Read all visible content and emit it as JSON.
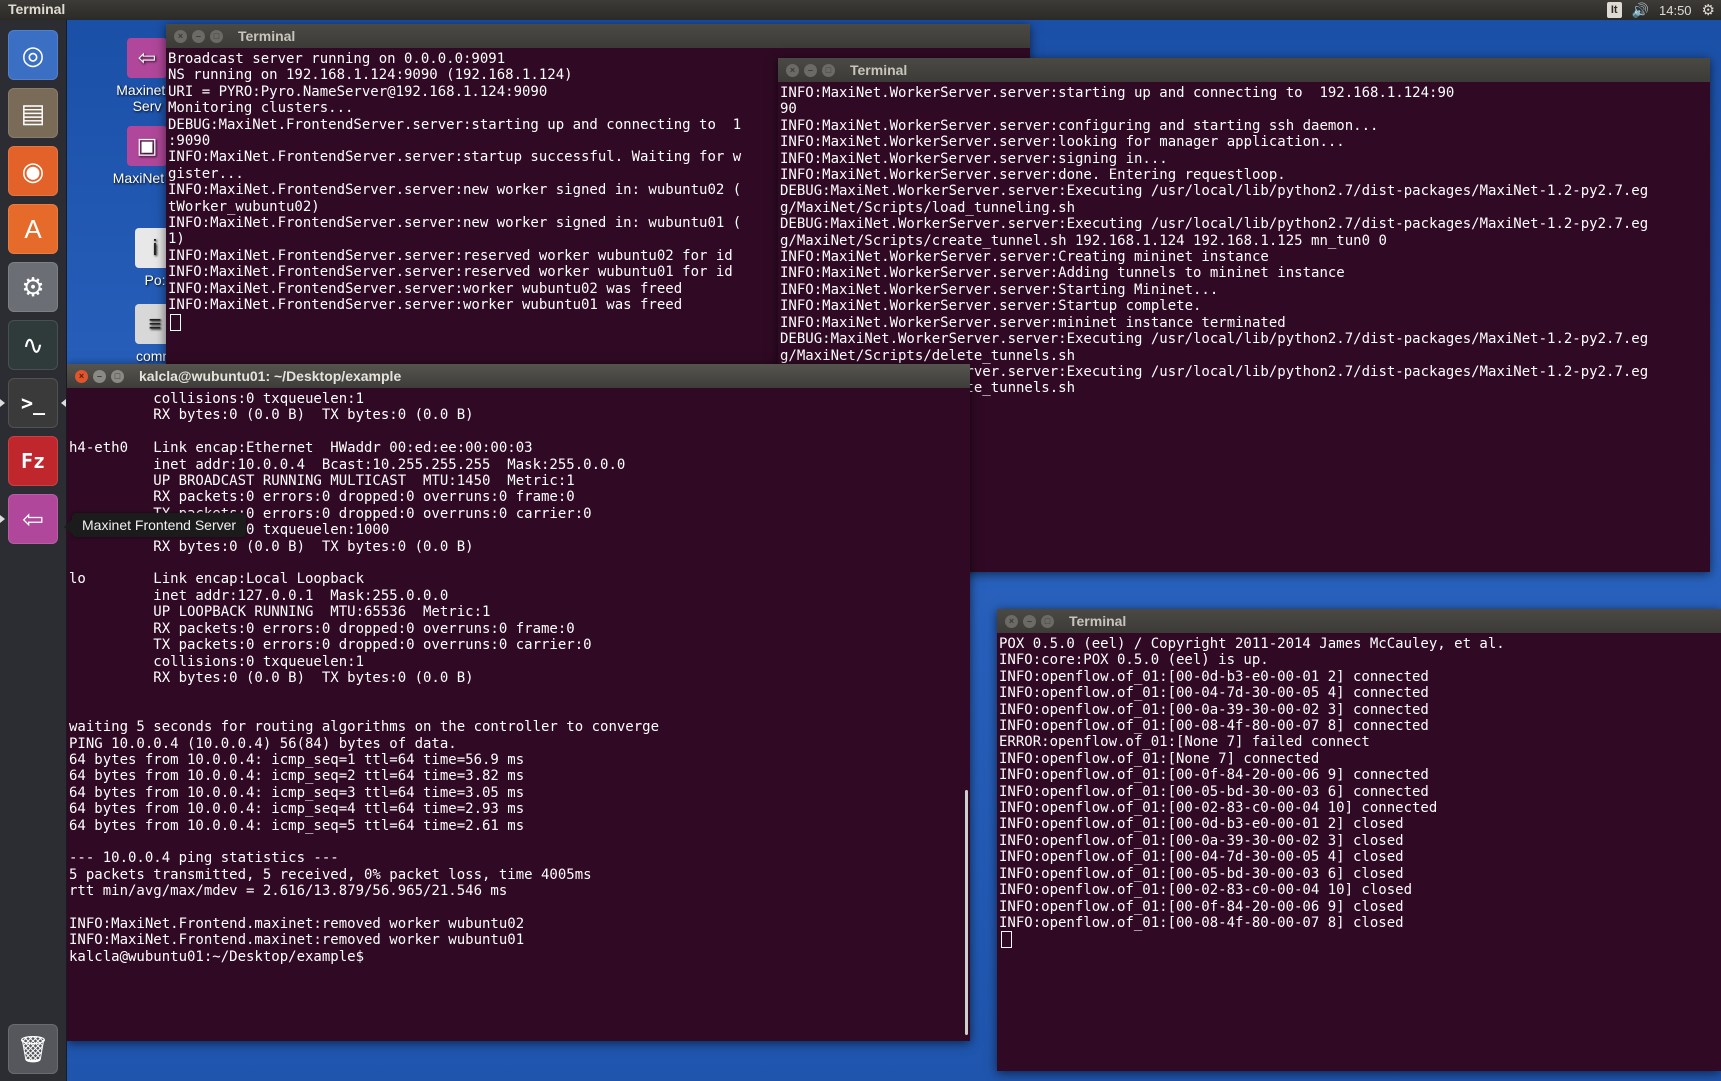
{
  "top_panel": {
    "app_title": "Terminal",
    "keyboard": "It",
    "volume_icon": "volume-icon",
    "clock": "14:50",
    "settings_icon": "gear-icon"
  },
  "launcher": {
    "items": [
      {
        "name": "dash-icon",
        "glyph": "◎",
        "bg": "#3b6fc4"
      },
      {
        "name": "files-icon",
        "glyph": "▤",
        "bg": "#7a6a58"
      },
      {
        "name": "firefox-icon",
        "glyph": "◉",
        "bg": "#e2622a"
      },
      {
        "name": "software-center-icon",
        "glyph": "A",
        "bg": "#e66a2a"
      },
      {
        "name": "system-settings-icon",
        "glyph": "⚙",
        "bg": "#6b6f75"
      },
      {
        "name": "system-monitor-icon",
        "glyph": "∿",
        "bg": "#2f3a3a"
      },
      {
        "name": "terminal-icon",
        "glyph": ">_",
        "bg": "#3a3a3a"
      },
      {
        "name": "filezilla-icon",
        "glyph": "Fz",
        "bg": "#c0272d"
      },
      {
        "name": "maxinet-frontend-icon",
        "glyph": "⇦",
        "bg": "#b0479a"
      }
    ],
    "trash_glyph": "🗑",
    "tooltip": "Maxinet Frontend Server"
  },
  "desktop_icons": [
    {
      "label": "Maxinet F\nServ",
      "glyph": "⇦",
      "bg": "#b0479a"
    },
    {
      "label": "MaxiNet W",
      "glyph": "▣",
      "bg": "#b0479a"
    },
    {
      "label": "Po:",
      "glyph": "i",
      "bg": "#e8e8e8"
    },
    {
      "label": "comm",
      "glyph": "≡",
      "bg": "#d8d8d8"
    }
  ],
  "windows": {
    "frontend": {
      "title": "Terminal",
      "lines": "Broadcast server running on 0.0.0.0:9091\nNS running on 192.168.1.124:9090 (192.168.1.124)\nURI = PYRO:Pyro.NameServer@192.168.1.124:9090\nMonitoring clusters...\nDEBUG:MaxiNet.FrontendServer.server:starting up and connecting to  1\n:9090\nINFO:MaxiNet.FrontendServer.server:startup successful. Waiting for w\ngister...\nINFO:MaxiNet.FrontendServer.server:new worker signed in: wubuntu02 (\ntWorker_wubuntu02)\nINFO:MaxiNet.FrontendServer.server:new worker signed in: wubuntu01 (\n1)\nINFO:MaxiNet.FrontendServer.server:reserved worker wubuntu02 for id\nINFO:MaxiNet.FrontendServer.server:reserved worker wubuntu01 for id\nINFO:MaxiNet.FrontendServer.server:worker wubuntu02 was freed\nINFO:MaxiNet.FrontendServer.server:worker wubuntu01 was freed"
    },
    "worker": {
      "title": "Terminal",
      "lines": "INFO:MaxiNet.WorkerServer.server:starting up and connecting to  192.168.1.124:90\n90\nINFO:MaxiNet.WorkerServer.server:configuring and starting ssh daemon...\nINFO:MaxiNet.WorkerServer.server:looking for manager application...\nINFO:MaxiNet.WorkerServer.server:signing in...\nINFO:MaxiNet.WorkerServer.server:done. Entering requestloop.\nDEBUG:MaxiNet.WorkerServer.server:Executing /usr/local/lib/python2.7/dist-packages/MaxiNet-1.2-py2.7.eg\ng/MaxiNet/Scripts/load_tunneling.sh\nDEBUG:MaxiNet.WorkerServer.server:Executing /usr/local/lib/python2.7/dist-packages/MaxiNet-1.2-py2.7.eg\ng/MaxiNet/Scripts/create_tunnel.sh 192.168.1.124 192.168.1.125 mn_tun0 0\nINFO:MaxiNet.WorkerServer.server:Creating mininet instance\nINFO:MaxiNet.WorkerServer.server:Adding tunnels to mininet instance\nINFO:MaxiNet.WorkerServer.server:Starting Mininet...\nINFO:MaxiNet.WorkerServer.server:Startup complete.\nINFO:MaxiNet.WorkerServer.server:mininet instance terminated\nDEBUG:MaxiNet.WorkerServer.server:Executing /usr/local/lib/python2.7/dist-packages/MaxiNet-1.2-py2.7.eg\ng/MaxiNet/Scripts/delete_tunnels.sh\nDEBUG:MaxiNet.WorkerServer.server:Executing /usr/local/lib/python2.7/dist-packages/MaxiNet-1.2-py2.7.eg\ng/MaxiNet/Scripts/delete_tunnels.sh"
    },
    "main": {
      "title": "kalcla@wubuntu01: ~/Desktop/example",
      "lines": "          collisions:0 txqueuelen:1\n          RX bytes:0 (0.0 B)  TX bytes:0 (0.0 B)\n\nh4-eth0   Link encap:Ethernet  HWaddr 00:ed:ee:00:00:03\n          inet addr:10.0.0.4  Bcast:10.255.255.255  Mask:255.0.0.0\n          UP BROADCAST RUNNING MULTICAST  MTU:1450  Metric:1\n          RX packets:0 errors:0 dropped:0 overruns:0 frame:0\n          TX packets:0 errors:0 dropped:0 overruns:0 carrier:0\n          collisions:0 txqueuelen:1000\n          RX bytes:0 (0.0 B)  TX bytes:0 (0.0 B)\n\nlo        Link encap:Local Loopback\n          inet addr:127.0.0.1  Mask:255.0.0.0\n          UP LOOPBACK RUNNING  MTU:65536  Metric:1\n          RX packets:0 errors:0 dropped:0 overruns:0 frame:0\n          TX packets:0 errors:0 dropped:0 overruns:0 carrier:0\n          collisions:0 txqueuelen:1\n          RX bytes:0 (0.0 B)  TX bytes:0 (0.0 B)\n\n\nwaiting 5 seconds for routing algorithms on the controller to converge\nPING 10.0.0.4 (10.0.0.4) 56(84) bytes of data.\n64 bytes from 10.0.0.4: icmp_seq=1 ttl=64 time=56.9 ms\n64 bytes from 10.0.0.4: icmp_seq=2 ttl=64 time=3.82 ms\n64 bytes from 10.0.0.4: icmp_seq=3 ttl=64 time=3.05 ms\n64 bytes from 10.0.0.4: icmp_seq=4 ttl=64 time=2.93 ms\n64 bytes from 10.0.0.4: icmp_seq=5 ttl=64 time=2.61 ms\n\n--- 10.0.0.4 ping statistics ---\n5 packets transmitted, 5 received, 0% packet loss, time 4005ms\nrtt min/avg/max/mdev = 2.616/13.879/56.965/21.546 ms\n\nINFO:MaxiNet.Frontend.maxinet:removed worker wubuntu02\nINFO:MaxiNet.Frontend.maxinet:removed worker wubuntu01",
      "prompt": "kalcla@wubuntu01:~/Desktop/example$ "
    },
    "pox": {
      "title": "Terminal",
      "lines": "POX 0.5.0 (eel) / Copyright 2011-2014 James McCauley, et al.\nINFO:core:POX 0.5.0 (eel) is up.\nINFO:openflow.of_01:[00-0d-b3-e0-00-01 2] connected\nINFO:openflow.of_01:[00-04-7d-30-00-05 4] connected\nINFO:openflow.of_01:[00-0a-39-30-00-02 3] connected\nINFO:openflow.of_01:[00-08-4f-80-00-07 8] connected\nERROR:openflow.of_01:[None 7] failed connect\nINFO:openflow.of_01:[None 7] connected\nINFO:openflow.of_01:[00-0f-84-20-00-06 9] connected\nINFO:openflow.of_01:[00-05-bd-30-00-03 6] connected\nINFO:openflow.of_01:[00-02-83-c0-00-04 10] connected\nINFO:openflow.of_01:[00-0d-b3-e0-00-01 2] closed\nINFO:openflow.of_01:[00-0a-39-30-00-02 3] closed\nINFO:openflow.of_01:[00-04-7d-30-00-05 4] closed\nINFO:openflow.of_01:[00-05-bd-30-00-03 6] closed\nINFO:openflow.of_01:[00-02-83-c0-00-04 10] closed\nINFO:openflow.of_01:[00-0f-84-20-00-06 9] closed\nINFO:openflow.of_01:[00-08-4f-80-00-07 8] closed"
    }
  }
}
